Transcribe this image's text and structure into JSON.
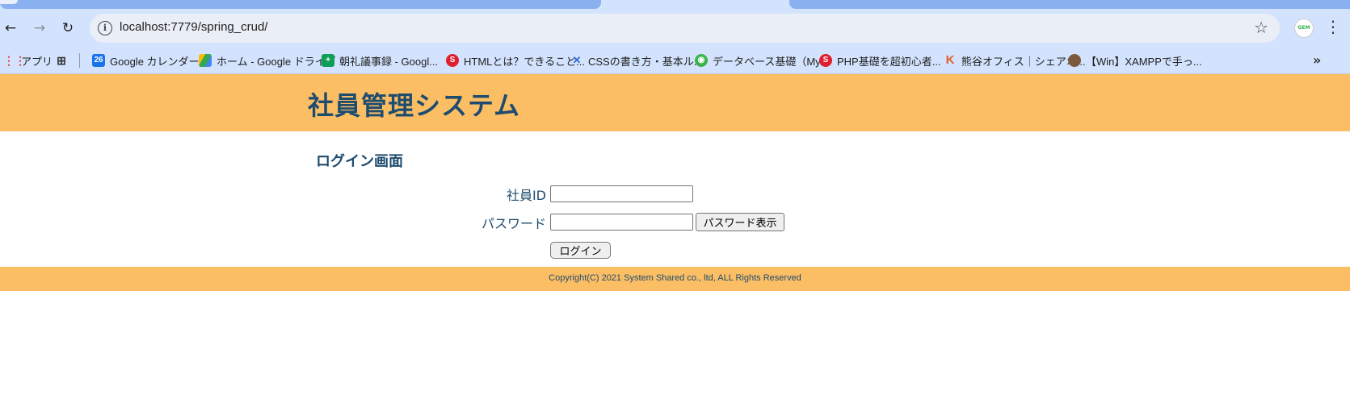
{
  "browser": {
    "url": "localhost:7779/spring_crud/",
    "profile_label": "GEM",
    "bookmarks": [
      {
        "label": "アプリ",
        "icon": "apps-grid-icon",
        "color": "#ea4335"
      },
      {
        "label": "",
        "icon": "grid-icon",
        "color": "#333333"
      },
      {
        "label": "Google カレンダー -",
        "icon": "calendar-icon",
        "color": "#1a73e8",
        "icon_text": "26"
      },
      {
        "label": "ホーム - Google ドライブ",
        "icon": "drive-icon",
        "color": "#34a853"
      },
      {
        "label": "朝礼議事録 - Googl...",
        "icon": "sheets-icon",
        "color": "#0f9d58"
      },
      {
        "label": "HTMLとは？できること...",
        "icon": "site-icon",
        "color": "#e0202e"
      },
      {
        "label": "CSSの書き方・基本ル...",
        "icon": "css-site-icon",
        "color": "#2e6bd8"
      },
      {
        "label": "データベース基礎（My...",
        "icon": "db-site-icon",
        "color": "#3bb34a"
      },
      {
        "label": "PHP基礎を超初心者...",
        "icon": "site-icon",
        "color": "#e0202e"
      },
      {
        "label": "熊谷オフィス｜シェアオ...",
        "icon": "k-logo-icon",
        "color": "#e0602e"
      },
      {
        "label": "【Win】XAMPPで手っ...",
        "icon": "avatar-icon",
        "color": "#7a5a3a"
      }
    ]
  },
  "page": {
    "title": "社員管理システム",
    "heading": "ログイン画面",
    "id_label": "社員ID",
    "password_label": "パスワード",
    "show_password_button": "パスワード表示",
    "login_button": "ログイン",
    "footer": "Copyright(C) 2021 System Shared co., ltd, ALL Rights Reserved"
  },
  "colors": {
    "header_bg": "#fbbe64",
    "text_primary": "#1e4c6f",
    "chrome_bg": "#d3e3fd"
  }
}
